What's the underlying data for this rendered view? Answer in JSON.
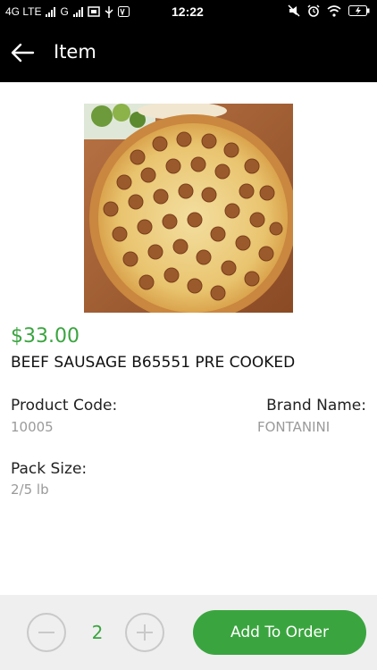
{
  "status_bar": {
    "network": "4G LTE",
    "network2": "G",
    "time": "12:22"
  },
  "app_bar": {
    "title": "Item"
  },
  "product": {
    "price": "$33.00",
    "name": "BEEF SAUSAGE B65551 PRE COOKED",
    "product_code_label": "Product Code:",
    "product_code": "10005",
    "brand_name_label": "Brand Name:",
    "brand_name": "FONTANINI",
    "pack_size_label": "Pack Size:",
    "pack_size": "2/5 lb",
    "image": "pizza-image"
  },
  "footer": {
    "quantity": "2",
    "add_button_label": "Add To Order"
  },
  "colors": {
    "accent": "#3aa53f",
    "app_bar": "#000000",
    "footer_bg": "#efefef"
  }
}
